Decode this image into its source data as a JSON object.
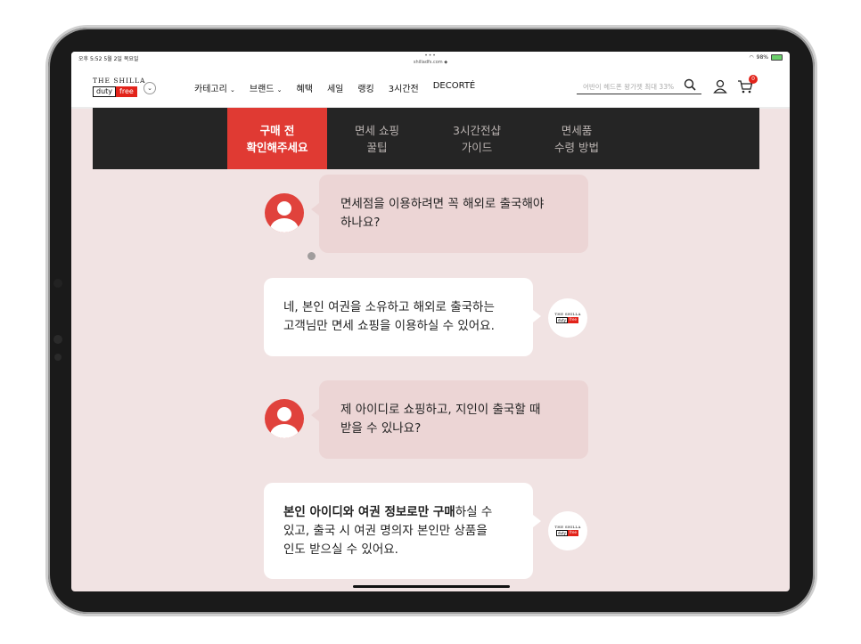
{
  "status_bar": {
    "time": "오후 5:52",
    "date": "5월 2일 목요일",
    "dots": "•••",
    "url": "shilladfs.com",
    "battery": "98%"
  },
  "header": {
    "logo_top": "THE SHILLA",
    "logo_duty": "duty",
    "logo_free": "free",
    "nav": [
      {
        "label": "카테고리",
        "chevron": "⌄"
      },
      {
        "label": "브랜드",
        "chevron": "⌄"
      },
      {
        "label": "혜택",
        "chevron": ""
      },
      {
        "label": "세일",
        "chevron": ""
      },
      {
        "label": "랭킹",
        "chevron": ""
      },
      {
        "label": "3시간전",
        "chevron": ""
      },
      {
        "label": "DECORTÉ",
        "chevron": ""
      }
    ],
    "search_placeholder": "어반이 헤드폰 왕가젯 최대 33%",
    "cart_count": "0"
  },
  "tabs": [
    {
      "line1": "구매 전",
      "line2": "확인해주세요",
      "active": true
    },
    {
      "line1": "면세 쇼핑",
      "line2": "꿀팁",
      "active": false
    },
    {
      "line1": "3시간전샵",
      "line2": "가이드",
      "active": false
    },
    {
      "line1": "면세품",
      "line2": "수령 방법",
      "active": false
    }
  ],
  "chat": {
    "q1_line1": "면세점을 이용하려면 꼭 해외로 출국해야",
    "q1_line2": "하나요?",
    "a1_line1": "네, 본인 여권을 소유하고 해외로 출국하는",
    "a1_line2": "고객님만 면세 쇼핑을 이용하실 수 있어요.",
    "q2_line1": "제 아이디로 쇼핑하고, 지인이 출국할 때",
    "q2_line2": "받을 수 있나요?",
    "a2_bold": "본인 아이디와 여권 정보로만 구매",
    "a2_rest1": "하실 수",
    "a2_line2": "있고, 출국 시 여권 명의자 본인만 상품을",
    "a2_line3": "인도 받으실 수 있어요."
  },
  "brand_badge": {
    "top": "THE SHILLA",
    "duty": "duty",
    "free": "free"
  },
  "colors": {
    "accent": "#e03a33",
    "tab_bg": "#252525",
    "page_bg": "#f1e3e3",
    "question_bubble": "#ecd5d5"
  }
}
